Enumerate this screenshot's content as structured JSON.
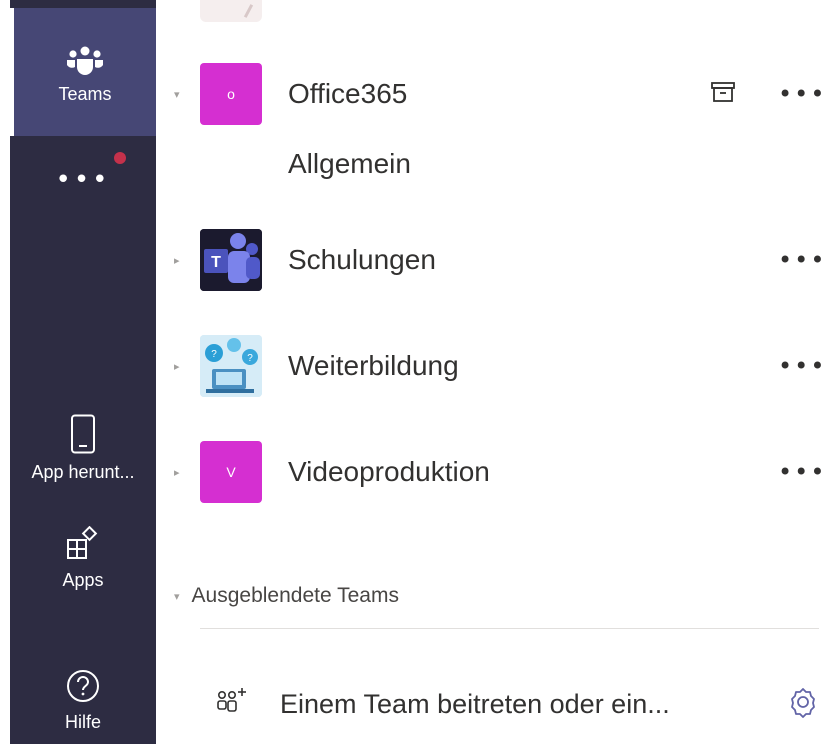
{
  "rail": {
    "items": [
      {
        "label": "Teams",
        "icon": "teams-icon",
        "active": true
      },
      {
        "label": "",
        "icon": "more-icon",
        "notification": true
      },
      {
        "label": "App herunt...",
        "icon": "mobile-device-icon"
      },
      {
        "label": "Apps",
        "icon": "apps-icon"
      },
      {
        "label": "Hilfe",
        "icon": "help-icon"
      }
    ],
    "more_glyph": "•••"
  },
  "teams": [
    {
      "name": "Office365",
      "avatar_letter": "O",
      "avatar_color": "#d52fd1",
      "expanded": true,
      "archived": true,
      "channels": [
        "Allgemein"
      ]
    },
    {
      "name": "Schulungen",
      "avatar_letter": "",
      "avatar_type": "image-teams-logo",
      "expanded": false
    },
    {
      "name": "Weiterbildung",
      "avatar_letter": "",
      "avatar_type": "image-illustration",
      "expanded": false
    },
    {
      "name": "Videoproduktion",
      "avatar_letter": "V",
      "avatar_color": "#d52fd1",
      "expanded": false
    }
  ],
  "row_more_glyph": "•••",
  "chevron_right": "▸",
  "chevron_down": "▾",
  "hidden_teams": {
    "label": "Ausgeblendete Teams"
  },
  "join": {
    "label": "Einem Team beitreten oder ein..."
  },
  "colors": {
    "rail_bg": "#2d2c42",
    "rail_active": "#464775",
    "accent_magenta": "#d52fd1",
    "notification_red": "#c4314b",
    "gear_purple": "#6264a7"
  }
}
